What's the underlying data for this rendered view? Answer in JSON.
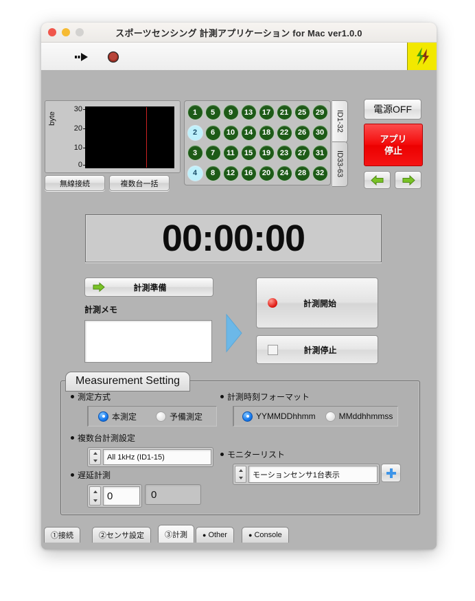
{
  "window": {
    "title": "スポーツセンシング 計測アプリケーション for Mac ver1.0.0"
  },
  "toolbar": {
    "run_icon": "run-arrow-icon",
    "stop_icon": "stop-circle-icon",
    "logo": "sports-sensing-logo",
    "logo_colors": {
      "background": "#f2e800",
      "mark_green": "#3ea011",
      "mark_dark": "#8a3510"
    }
  },
  "chart_data": {
    "type": "line",
    "title": "",
    "xlabel": "",
    "ylabel": "byte",
    "yticks": [
      0,
      10,
      20,
      30
    ],
    "ylim": [
      0,
      30
    ],
    "grid": false,
    "legend": "none",
    "series": [
      {
        "name": "byte",
        "values": []
      }
    ],
    "cursor_color": "#cf2222",
    "plot_background": "#000000"
  },
  "left_buttons": [
    {
      "label": "無線接続",
      "name": "wireless-connect-button"
    },
    {
      "label": "複数台一括",
      "name": "multi-device-batch-button"
    }
  ],
  "sensor_grid": {
    "selected_color": "#bdf0fb",
    "normal_color": "#1d5a17",
    "selected_ids": [
      2,
      4
    ],
    "columns": [
      [
        1,
        2,
        3,
        4
      ],
      [
        5,
        6,
        7,
        8
      ],
      [
        9,
        10,
        11,
        12
      ],
      [
        13,
        14,
        15,
        16
      ],
      [
        17,
        18,
        19,
        20
      ],
      [
        21,
        22,
        23,
        24
      ],
      [
        25,
        26,
        27,
        28
      ],
      [
        29,
        30,
        31,
        32
      ]
    ],
    "id_tabs": [
      {
        "label": "ID1-32",
        "active": true
      },
      {
        "label": "ID33-63",
        "active": false
      }
    ]
  },
  "right_controls": {
    "power_label": "電源OFF",
    "app_stop_line1": "アプリ",
    "app_stop_line2": "停止",
    "app_stop_color": "#ee0b0b",
    "prev_icon": "arrow-left-icon",
    "next_icon": "arrow-right-icon"
  },
  "timer": {
    "value": "00:00:00"
  },
  "middle": {
    "prepare_label": "計測準備",
    "prepare_icon": "green-arrow-right-icon",
    "memo_label": "計測メモ",
    "memo_value": "",
    "memo_placeholder": "",
    "flow_arrow_icon": "blue-triangle-right-icon",
    "start_label": "計測開始",
    "start_led_color": "#e01b14",
    "stop_label": "計測停止"
  },
  "settings": {
    "tab_title": "Measurement Setting",
    "method": {
      "title": "測定方式",
      "options": [
        {
          "label": "本測定",
          "selected": true
        },
        {
          "label": "予備測定",
          "selected": false
        }
      ]
    },
    "multi_device": {
      "title": "複数台計測設定",
      "value": "All 1kHz (ID1-15)"
    },
    "delay": {
      "title": "遅延計測",
      "value1": "0",
      "value2": "0"
    },
    "time_format": {
      "title": "計測時刻フォーマット",
      "options": [
        {
          "label": "YYMMDDhhmm",
          "selected": true
        },
        {
          "label": "MMddhhmmss",
          "selected": false
        }
      ]
    },
    "monitor_list": {
      "title": "モニターリスト",
      "value": "モーションセンサ1台表示",
      "add_icon": "plus-icon",
      "add_icon_color": "#3f95e8"
    }
  },
  "tabs": [
    {
      "label": "①接続",
      "marker": "",
      "active": false
    },
    {
      "label": "②センサ設定",
      "marker": "",
      "active": false
    },
    {
      "label": "③計測",
      "marker": "",
      "active": true
    },
    {
      "label": "Other",
      "marker": "●",
      "active": false
    },
    {
      "label": "Console",
      "marker": "●",
      "active": false
    }
  ]
}
